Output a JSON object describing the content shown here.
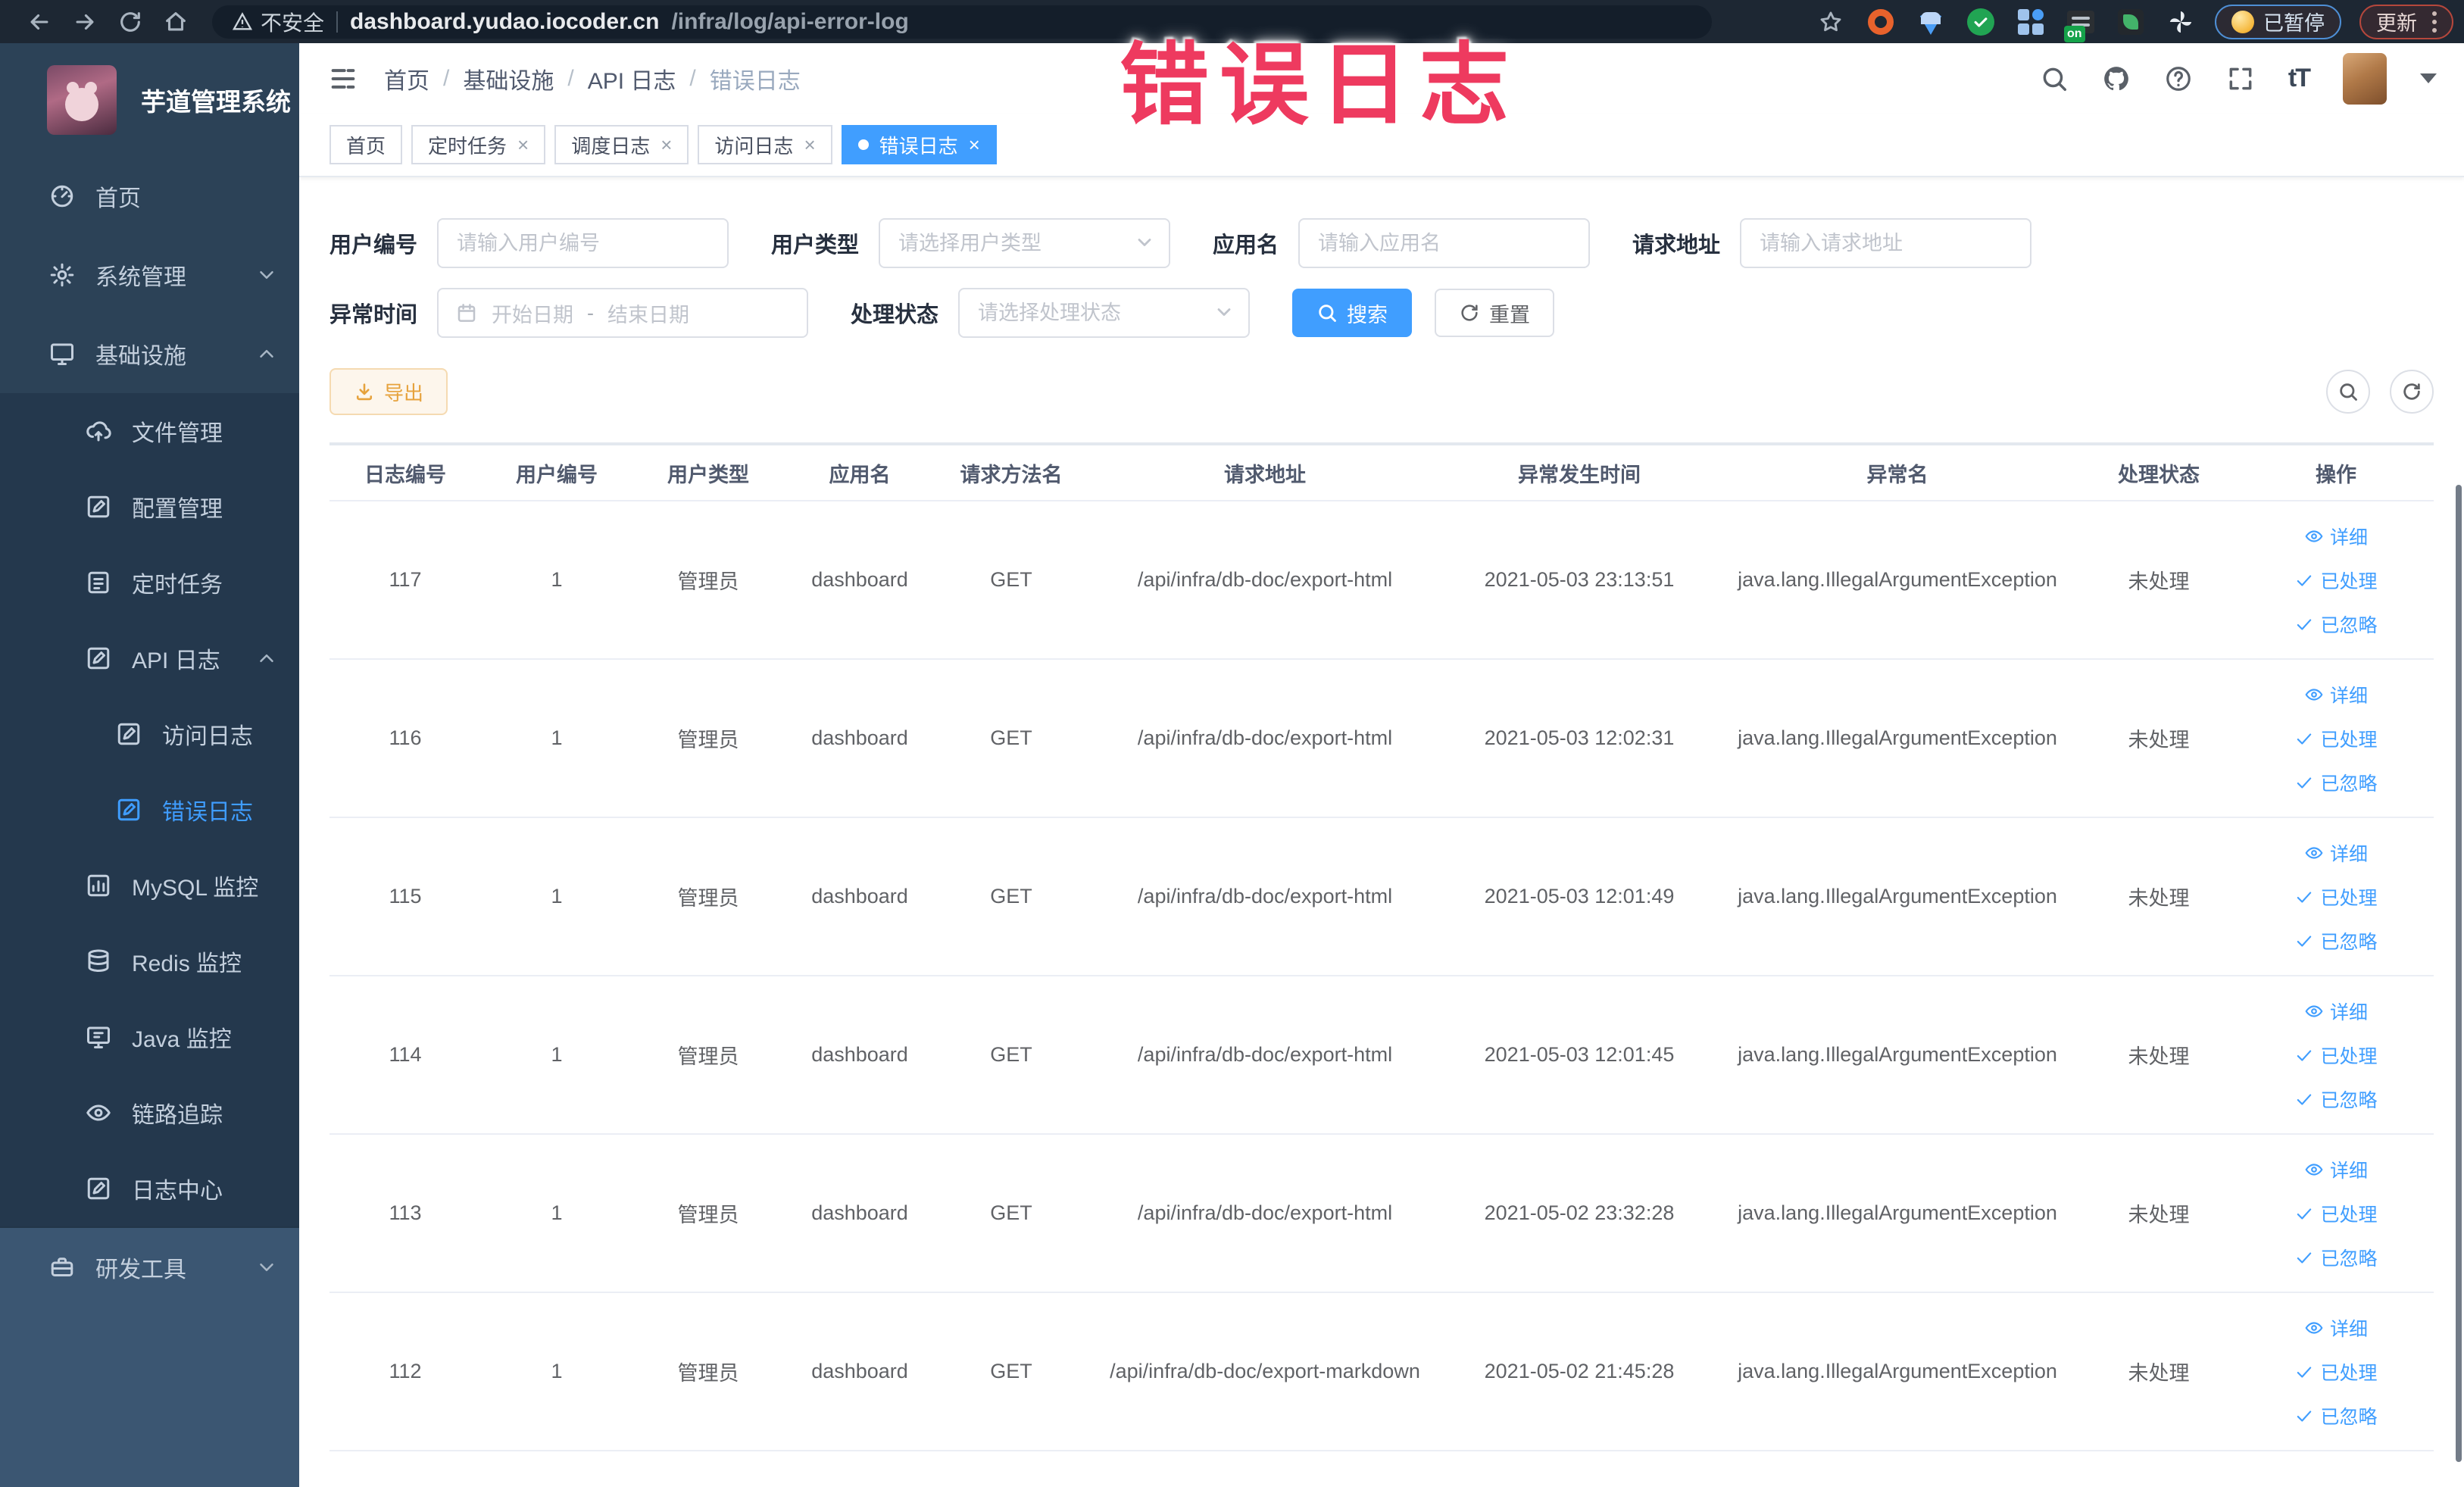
{
  "browser": {
    "security_label": "不安全",
    "url_host": "dashboard.yudao.iocoder.cn",
    "url_path": "/infra/log/api-error-log",
    "extension_badge": "on",
    "paused_label": "已暂停",
    "update_label": "更新"
  },
  "annotation": {
    "text": "错误日志",
    "color": "#ee3a5f"
  },
  "sidebar": {
    "title": "芋道管理系统",
    "items": [
      {
        "label": "首页",
        "icon": "gauge-icon",
        "level": 0
      },
      {
        "label": "系统管理",
        "icon": "gear-icon",
        "level": 0,
        "chevron": "down"
      },
      {
        "label": "基础设施",
        "icon": "monitor-icon",
        "level": 0,
        "chevron": "up"
      },
      {
        "label": "文件管理",
        "icon": "cloud-upload-icon",
        "level": 1,
        "sub": true
      },
      {
        "label": "配置管理",
        "icon": "edit-icon",
        "level": 1,
        "sub": true
      },
      {
        "label": "定时任务",
        "icon": "todo-icon",
        "level": 1,
        "sub": true
      },
      {
        "label": "API 日志",
        "icon": "edit-icon",
        "level": 1,
        "sub": true,
        "chevron": "up"
      },
      {
        "label": "访问日志",
        "icon": "edit-icon",
        "level": 2,
        "sub": true
      },
      {
        "label": "错误日志",
        "icon": "edit-icon",
        "level": 2,
        "sub": true,
        "active": true
      },
      {
        "label": "MySQL 监控",
        "icon": "chart-icon",
        "level": 1,
        "sub": true
      },
      {
        "label": "Redis 监控",
        "icon": "database-icon",
        "level": 1,
        "sub": true
      },
      {
        "label": "Java 监控",
        "icon": "java-monitor-icon",
        "level": 1,
        "sub": true
      },
      {
        "label": "链路追踪",
        "icon": "eye-icon",
        "level": 1,
        "sub": true
      },
      {
        "label": "日志中心",
        "icon": "edit-icon",
        "level": 1,
        "sub": true
      },
      {
        "label": "研发工具",
        "icon": "toolbox-icon",
        "level": 0,
        "chevron": "down",
        "section": "bottom"
      }
    ]
  },
  "header": {
    "breadcrumb": [
      "首页",
      "基础设施",
      "API 日志",
      "错误日志"
    ]
  },
  "tabs": [
    {
      "label": "首页",
      "closable": false,
      "active": false
    },
    {
      "label": "定时任务",
      "closable": true,
      "active": false
    },
    {
      "label": "调度日志",
      "closable": true,
      "active": false
    },
    {
      "label": "访问日志",
      "closable": true,
      "active": false
    },
    {
      "label": "错误日志",
      "closable": true,
      "active": true
    }
  ],
  "filters": {
    "user_id": {
      "label": "用户编号",
      "placeholder": "请输入用户编号"
    },
    "user_type": {
      "label": "用户类型",
      "placeholder": "请选择用户类型"
    },
    "app_name": {
      "label": "应用名",
      "placeholder": "请输入应用名"
    },
    "request_url": {
      "label": "请求地址",
      "placeholder": "请输入请求地址"
    },
    "exception_time": {
      "label": "异常时间",
      "start_placeholder": "开始日期",
      "separator": "-",
      "end_placeholder": "结束日期"
    },
    "process_status": {
      "label": "处理状态",
      "placeholder": "请选择处理状态"
    },
    "search_label": "搜索",
    "reset_label": "重置"
  },
  "toolbar": {
    "export_label": "导出"
  },
  "table": {
    "headers": [
      "日志编号",
      "用户编号",
      "用户类型",
      "应用名",
      "请求方法名",
      "请求地址",
      "异常发生时间",
      "异常名",
      "处理状态",
      "操作"
    ],
    "actions": [
      "详细",
      "已处理",
      "已忽略"
    ],
    "rows": [
      {
        "id": "117",
        "user_id": "1",
        "user_type": "管理员",
        "app_name": "dashboard",
        "method": "GET",
        "url": "/api/infra/db-doc/export-html",
        "time": "2021-05-03 23:13:51",
        "exception": "java.lang.IllegalArgumentException",
        "status": "未处理"
      },
      {
        "id": "116",
        "user_id": "1",
        "user_type": "管理员",
        "app_name": "dashboard",
        "method": "GET",
        "url": "/api/infra/db-doc/export-html",
        "time": "2021-05-03 12:02:31",
        "exception": "java.lang.IllegalArgumentException",
        "status": "未处理"
      },
      {
        "id": "115",
        "user_id": "1",
        "user_type": "管理员",
        "app_name": "dashboard",
        "method": "GET",
        "url": "/api/infra/db-doc/export-html",
        "time": "2021-05-03 12:01:49",
        "exception": "java.lang.IllegalArgumentException",
        "status": "未处理"
      },
      {
        "id": "114",
        "user_id": "1",
        "user_type": "管理员",
        "app_name": "dashboard",
        "method": "GET",
        "url": "/api/infra/db-doc/export-html",
        "time": "2021-05-03 12:01:45",
        "exception": "java.lang.IllegalArgumentException",
        "status": "未处理"
      },
      {
        "id": "113",
        "user_id": "1",
        "user_type": "管理员",
        "app_name": "dashboard",
        "method": "GET",
        "url": "/api/infra/db-doc/export-html",
        "time": "2021-05-02 23:32:28",
        "exception": "java.lang.IllegalArgumentException",
        "status": "未处理"
      },
      {
        "id": "112",
        "user_id": "1",
        "user_type": "管理员",
        "app_name": "dashboard",
        "method": "GET",
        "url": "/api/infra/db-doc/export-markdown",
        "time": "2021-05-02 21:45:28",
        "exception": "java.lang.IllegalArgumentException",
        "status": "未处理"
      }
    ]
  },
  "colors": {
    "accent_blue": "#409eff",
    "sidebar_bg": "#2c4257",
    "chrome_bg": "#1d2733",
    "warn_button": "#e6a23c",
    "annotation_red": "#ee3a5f"
  }
}
